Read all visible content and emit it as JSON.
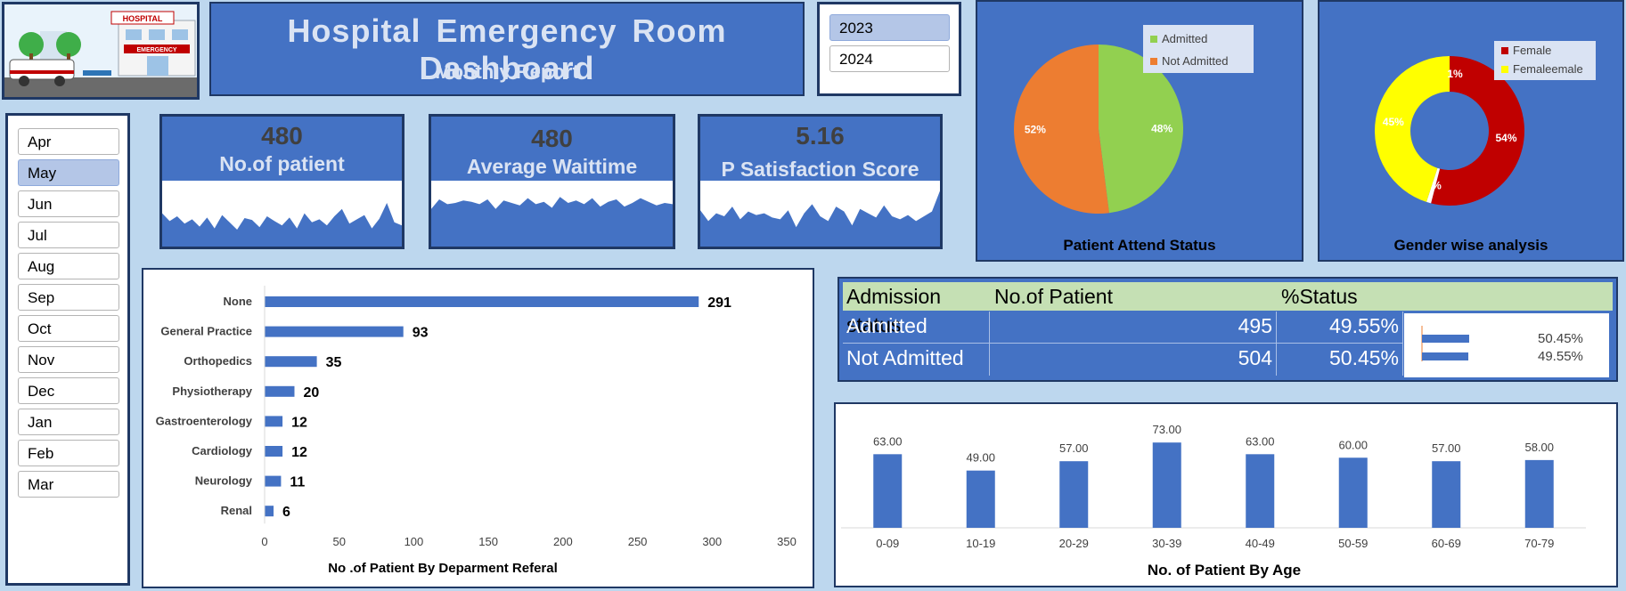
{
  "header": {
    "logo_text": "HOSPITAL",
    "logo_sign": "EMERGENCY",
    "title": "Hospital  Emergency Room  Dashboard",
    "subtitle": "Monthly Report"
  },
  "year_slicer": {
    "options": [
      "2023",
      "2024"
    ],
    "selected": "2023"
  },
  "month_slicer": {
    "options": [
      "Apr",
      "May",
      "Jun",
      "Jul",
      "Aug",
      "Sep",
      "Oct",
      "Nov",
      "Dec",
      "Jan",
      "Feb",
      "Mar"
    ],
    "selected": "May"
  },
  "kpis": [
    {
      "value": "480",
      "label": "No.of patient",
      "spark": [
        0.55,
        0.42,
        0.5,
        0.38,
        0.45,
        0.33,
        0.48,
        0.3,
        0.52,
        0.4,
        0.28,
        0.47,
        0.44,
        0.32,
        0.5,
        0.42,
        0.35,
        0.48,
        0.3,
        0.55,
        0.4,
        0.45,
        0.35,
        0.5,
        0.62,
        0.38,
        0.45,
        0.52,
        0.3,
        0.46,
        0.72,
        0.4,
        0.35
      ]
    },
    {
      "value": "480",
      "label": "Average Waittime",
      "spark": [
        0.62,
        0.78,
        0.7,
        0.72,
        0.76,
        0.74,
        0.7,
        0.78,
        0.62,
        0.76,
        0.72,
        0.68,
        0.8,
        0.7,
        0.74,
        0.64,
        0.82,
        0.72,
        0.76,
        0.7,
        0.8,
        0.66,
        0.74,
        0.78,
        0.66,
        0.72,
        0.8,
        0.74,
        0.68,
        0.72,
        0.7
      ]
    },
    {
      "value": "5.16",
      "label": "P Satisfaction Score",
      "spark": [
        0.6,
        0.42,
        0.55,
        0.5,
        0.66,
        0.45,
        0.58,
        0.52,
        0.55,
        0.48,
        0.45,
        0.6,
        0.32,
        0.55,
        0.7,
        0.5,
        0.42,
        0.66,
        0.58,
        0.35,
        0.62,
        0.55,
        0.48,
        0.68,
        0.5,
        0.45,
        0.52,
        0.42,
        0.5,
        0.58,
        0.92
      ]
    }
  ],
  "chart_data": [
    {
      "type": "pie",
      "title": "Patient Attend Status",
      "legend_position": "top-right",
      "slices": [
        {
          "name": "Admitted",
          "value": 48,
          "label": "48%",
          "color": "#92d050"
        },
        {
          "name": "Not Admitted",
          "value": 52,
          "label": "52%",
          "color": "#ed7d31"
        }
      ]
    },
    {
      "type": "pie",
      "style": "donut",
      "title": "Gender wise analysis",
      "legend_position": "top-right",
      "slices": [
        {
          "name": "Female",
          "value": 54,
          "label": "54%",
          "color": "#c00000"
        },
        {
          "name": "Female",
          "value": 1,
          "label": "6%",
          "color": "#ffffff"
        },
        {
          "name": "Femaleemale",
          "value": 45,
          "label": "45%",
          "color": "#ffff00"
        }
      ],
      "extra_labels": [
        "1%"
      ],
      "legend": [
        "Female",
        "Femaleemale"
      ]
    },
    {
      "type": "bar",
      "orientation": "horizontal",
      "title": "No .of Patient By  Deparment Referal",
      "categories": [
        "None",
        "General Practice",
        "Orthopedics",
        "Physiotherapy",
        "Gastroenterology",
        "Cardiology",
        "Neurology",
        "Renal"
      ],
      "values": [
        291,
        93,
        35,
        20,
        12,
        12,
        11,
        6
      ],
      "xlim": [
        0,
        350
      ],
      "xticks": [
        0,
        50,
        100,
        150,
        200,
        250,
        300,
        350
      ],
      "color": "#4472c4"
    },
    {
      "type": "bar",
      "title": "No. of Patient By Age",
      "categories": [
        "0-09",
        "10-19",
        "20-29",
        "30-39",
        "40-49",
        "50-59",
        "60-69",
        "70-79"
      ],
      "values": [
        63,
        49,
        57,
        73,
        63,
        60,
        57,
        58
      ],
      "value_labels": [
        "63.00",
        "49.00",
        "57.00",
        "73.00",
        "63.00",
        "60.00",
        "57.00",
        "58.00"
      ],
      "ylim": [
        0,
        80
      ],
      "color": "#4472c4"
    },
    {
      "type": "table",
      "columns": [
        "Admission status",
        "No.of Patient",
        "%Status"
      ],
      "rows": [
        [
          "Admitted",
          "495",
          "49.55%"
        ],
        [
          "Not Admitted",
          "504",
          "50.45%"
        ]
      ],
      "mini_bars": [
        {
          "label": "50.45%",
          "value": 50.45
        },
        {
          "label": "49.55%",
          "value": 49.55
        }
      ]
    }
  ],
  "colors": {
    "background": "#bdd7ee",
    "panel": "#4472c4",
    "border": "#1f3864",
    "table_header": "#c5e0b4"
  }
}
